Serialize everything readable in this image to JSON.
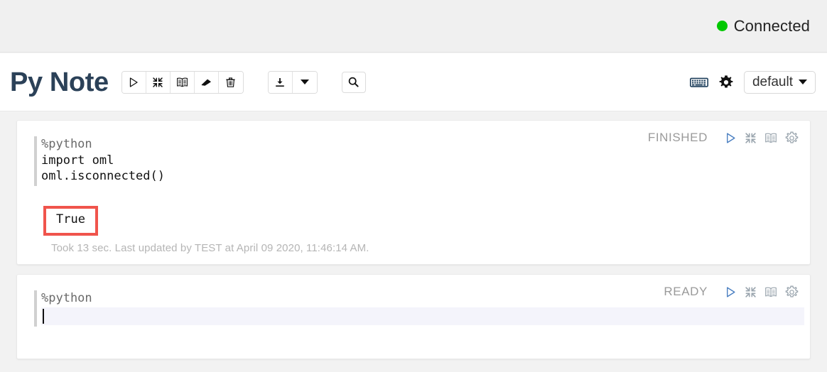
{
  "topbar": {
    "connection_status": "Connected",
    "connection_color": "#00c800",
    "status_icon": "green-circle-icon"
  },
  "toolbar": {
    "note_title": "Py Note",
    "actions": [
      {
        "name": "run-all-paragraphs-button",
        "icon": "play-triangle-icon"
      },
      {
        "name": "hide-all-output-button",
        "icon": "collapse-arrows-icon"
      },
      {
        "name": "toggle-all-code-button",
        "icon": "open-book-icon"
      },
      {
        "name": "clear-all-output-button",
        "icon": "eraser-icon"
      },
      {
        "name": "delete-note-button",
        "icon": "trash-icon"
      }
    ],
    "export_group": [
      {
        "name": "export-note-button",
        "icon": "download-icon"
      },
      {
        "name": "export-options-dropdown",
        "icon": "caret-down-icon"
      }
    ],
    "search_button": {
      "name": "search-code-button",
      "icon": "magnifier-icon"
    },
    "right_tools": [
      {
        "name": "keyboard-shortcuts-button",
        "icon": "keyboard-icon"
      },
      {
        "name": "note-settings-button",
        "icon": "gear-icon"
      }
    ],
    "interpreter_selector": {
      "label": "default",
      "icon": "caret-down-icon"
    }
  },
  "paragraphs": [
    {
      "id": "paragraph-1",
      "status": "FINISHED",
      "code": "%python\nimport oml\noml.isconnected()",
      "magic": "%python",
      "code_body": "import oml\noml.isconnected()",
      "output": "True",
      "output_highlight_color": "#f0544c",
      "footer": "Took 13 sec. Last updated by TEST at April 09 2020, 11:46:14 AM.",
      "controls": [
        {
          "name": "run-paragraph-button",
          "icon": "play-triangle-icon"
        },
        {
          "name": "hide-output-button",
          "icon": "collapse-arrows-icon"
        },
        {
          "name": "show-editor-button",
          "icon": "open-book-icon"
        },
        {
          "name": "paragraph-settings-button",
          "icon": "gear-icon"
        }
      ]
    },
    {
      "id": "paragraph-2",
      "status": "READY",
      "magic": "%python",
      "code_body": "",
      "controls": [
        {
          "name": "run-paragraph-button",
          "icon": "play-triangle-icon"
        },
        {
          "name": "hide-output-button",
          "icon": "collapse-arrows-icon"
        },
        {
          "name": "show-editor-button",
          "icon": "open-book-icon"
        },
        {
          "name": "paragraph-settings-button",
          "icon": "gear-icon"
        }
      ]
    }
  ]
}
